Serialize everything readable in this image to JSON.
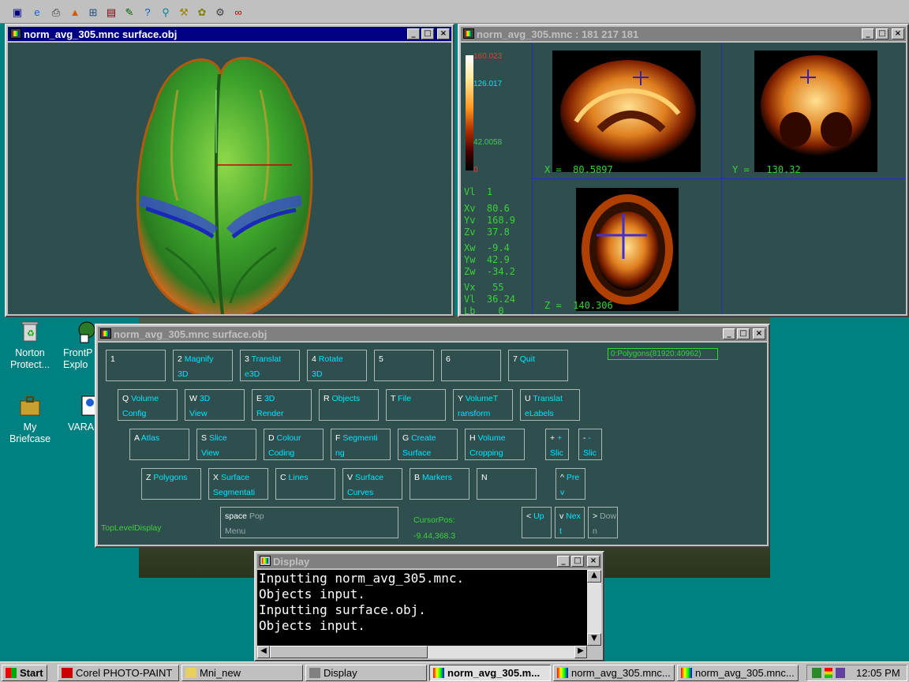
{
  "toolbar": {
    "icons": [
      "display-icon",
      "ie-icon",
      "printer-icon",
      "matlab-icon",
      "network-icon",
      "app-icon",
      "edit-icon",
      "help-icon",
      "query-icon",
      "tool-icon",
      "paint-icon",
      "chart-icon",
      "link-icon"
    ]
  },
  "surface_window": {
    "title": "norm_avg_305.mnc surface.obj"
  },
  "slice_window": {
    "title": "norm_avg_305.mnc : 181 217 181",
    "colorbar": {
      "max": "160.023",
      "v1": "126.017",
      "v2": "42.0058",
      "min": "0"
    },
    "x_label": "X =",
    "x_value": "80.5897",
    "y_label": "Y =",
    "y_value": "130.32",
    "z_label": "Z =",
    "z_value": "140.306",
    "readouts": [
      {
        "label": "Vl",
        "value": "1"
      },
      {
        "label": "Xv",
        "value": "80.6"
      },
      {
        "label": "Yv",
        "value": "168.9"
      },
      {
        "label": "Zv",
        "value": "37.8"
      },
      {
        "label": "Xw",
        "value": "-9.4"
      },
      {
        "label": "Yw",
        "value": "42.9"
      },
      {
        "label": "Zw",
        "value": "-34.2"
      },
      {
        "label": "Vx",
        "value": "55"
      },
      {
        "label": "Vl",
        "value": "36.24"
      },
      {
        "label": "Lb",
        "value": "0"
      }
    ]
  },
  "menu_window": {
    "title": "norm_avg_305.mnc surface.obj",
    "polygons_badge": "0:Polygons(81920:40962)",
    "top_level_label": "TopLevelDisplay",
    "cursor_label": "CursorPos:",
    "cursor_value": "-9.44,368.3",
    "keys": [
      {
        "key": "1",
        "l1": "",
        "l2": ""
      },
      {
        "key": "2",
        "l1": "Magnify",
        "l2": "3D"
      },
      {
        "key": "3",
        "l1": "Translat",
        "l2": "e3D"
      },
      {
        "key": "4",
        "l1": "Rotate",
        "l2": "3D"
      },
      {
        "key": "5",
        "l1": "",
        "l2": ""
      },
      {
        "key": "6",
        "l1": "",
        "l2": ""
      },
      {
        "key": "7",
        "l1": "Quit",
        "l2": ""
      },
      {
        "key": "Q",
        "l1": "Volume",
        "l2": "Config"
      },
      {
        "key": "W",
        "l1": "3D",
        "l2": "View"
      },
      {
        "key": "E",
        "l1": "3D",
        "l2": "Render"
      },
      {
        "key": "R",
        "l1": "Objects",
        "l2": ""
      },
      {
        "key": "T",
        "l1": "File",
        "l2": ""
      },
      {
        "key": "Y",
        "l1": "VolumeT",
        "l2": "ransform"
      },
      {
        "key": "U",
        "l1": "Translat",
        "l2": "eLabels"
      },
      {
        "key": "A",
        "l1": "Atlas",
        "l2": ""
      },
      {
        "key": "S",
        "l1": "Slice",
        "l2": "View"
      },
      {
        "key": "D",
        "l1": "Colour",
        "l2": "Coding"
      },
      {
        "key": "F",
        "l1": "Segmenti",
        "l2": "ng"
      },
      {
        "key": "G",
        "l1": "Create",
        "l2": "Surface"
      },
      {
        "key": "H",
        "l1": "Volume",
        "l2": "Cropping"
      },
      {
        "key": "+",
        "l1": "+",
        "l2": "Slic"
      },
      {
        "key": "-",
        "l1": "-",
        "l2": "Slic"
      },
      {
        "key": "Z",
        "l1": "Polygons",
        "l2": ""
      },
      {
        "key": "X",
        "l1": "Surface",
        "l2": "Segmentati"
      },
      {
        "key": "C",
        "l1": "Lines",
        "l2": ""
      },
      {
        "key": "V",
        "l1": "Surface",
        "l2": "Curves"
      },
      {
        "key": "B",
        "l1": "Markers",
        "l2": ""
      },
      {
        "key": "N",
        "l1": "",
        "l2": ""
      },
      {
        "key": "^",
        "l1": "Pre",
        "l2": "v"
      },
      {
        "key": "space",
        "l1": "Pop",
        "l2": "Menu"
      },
      {
        "key": "<",
        "l1": "Up",
        "l2": ""
      },
      {
        "key": "v",
        "l1": "Nex",
        "l2": "t"
      },
      {
        "key": ">",
        "l1": "Dow",
        "l2": "n"
      }
    ]
  },
  "console_window": {
    "title": "Display",
    "lines": [
      "Inputting norm_avg_305.mnc.",
      "Objects input.",
      "Inputting surface.obj.",
      "Objects input."
    ]
  },
  "desktop": {
    "icons": [
      {
        "label1": "Norton",
        "label2": "Protect..."
      },
      {
        "label1": "My",
        "label2": "Briefcase"
      },
      {
        "label1": "FrontP",
        "label2": "Explo"
      },
      {
        "label1": "VARA",
        "label2": ""
      }
    ]
  },
  "taskbar": {
    "start": "Start",
    "tasks": [
      "Corel PHOTO-PAINT",
      "Mni_new",
      "Display",
      "norm_avg_305.m...",
      "norm_avg_305.mnc...",
      "norm_avg_305.mnc..."
    ],
    "clock": "12:05 PM"
  }
}
